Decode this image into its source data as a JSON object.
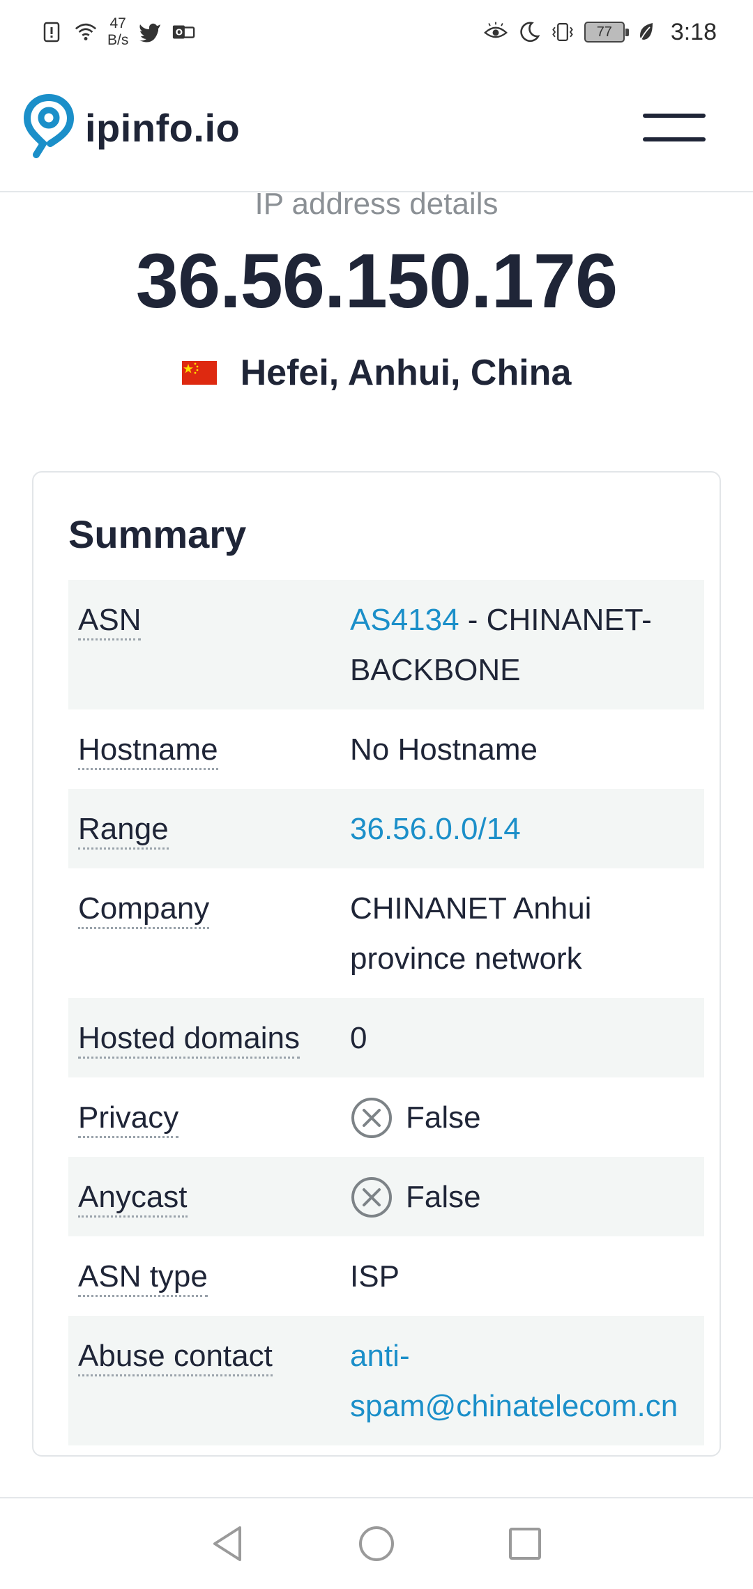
{
  "status_bar": {
    "net_speed_value": "47",
    "net_speed_unit": "B/s",
    "battery": "77",
    "time": "3:18",
    "icons": [
      "alert-icon",
      "wifi-icon",
      "twitter-icon",
      "mail-icon",
      "eye-icon",
      "moon-icon",
      "vibrate-icon",
      "battery-icon",
      "leaf-icon"
    ]
  },
  "header": {
    "brand": "ipinfo.io",
    "brand_color": "#1b8fc9",
    "menu_icon": "hamburger-icon"
  },
  "hero": {
    "subtitle": "IP address details",
    "ip": "36.56.150.176",
    "location": "Hefei, Anhui, China",
    "flag_icon": "china-flag-icon"
  },
  "summary": {
    "title": "Summary",
    "asn_label": "ASN",
    "asn_link": "AS4134",
    "asn_rest": " - CHINANET-BACKBONE",
    "hostname_label": "Hostname",
    "hostname_value": "No Hostname",
    "range_label": "Range",
    "range_value": "36.56.0.0/14",
    "company_label": "Company",
    "company_value": "CHINANET Anhui province network",
    "hosted_label": "Hosted domains",
    "hosted_value": "0",
    "privacy_label": "Privacy",
    "privacy_value": "False",
    "anycast_label": "Anycast",
    "anycast_value": "False",
    "asn_type_label": "ASN type",
    "asn_type_value": "ISP",
    "abuse_label": "Abuse contact",
    "abuse_value": "anti-spam@chinatelecom.cn",
    "link_color": "#1b8fc9",
    "row_alt_color": "#f3f6f5"
  },
  "navbar": {
    "icons": [
      "back-icon",
      "home-icon",
      "recents-icon"
    ]
  }
}
